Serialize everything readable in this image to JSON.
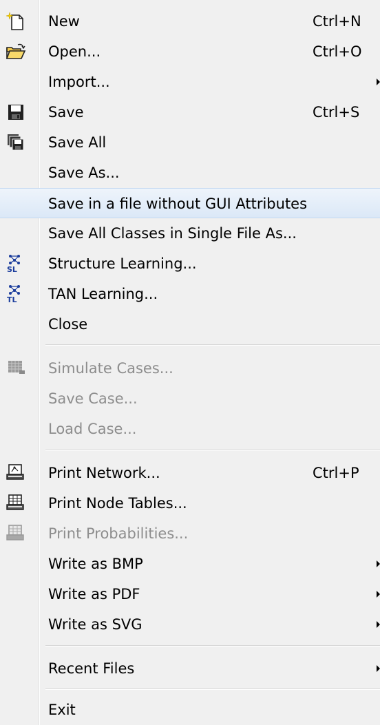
{
  "menu": {
    "items": [
      {
        "label": "New",
        "shortcut": "Ctrl+N",
        "icon": "new-file-icon"
      },
      {
        "label": "Open...",
        "shortcut": "Ctrl+O",
        "icon": "open-folder-icon"
      },
      {
        "label": "Import...",
        "submenu": true
      },
      {
        "label": "Save",
        "shortcut": "Ctrl+S",
        "icon": "save-icon"
      },
      {
        "label": "Save All",
        "icon": "save-all-icon"
      },
      {
        "label": "Save As..."
      },
      {
        "label": "Save in a file without GUI Attributes",
        "highlighted": true
      },
      {
        "label": "Save All Classes in Single File As..."
      },
      {
        "label": "Structure Learning...",
        "icon": "structure-learning-icon",
        "icon_text": "SL"
      },
      {
        "label": "TAN Learning...",
        "icon": "tan-learning-icon",
        "icon_text": "TL"
      },
      {
        "label": "Close"
      },
      {
        "label": "Simulate Cases...",
        "disabled": true,
        "icon": "simulate-cases-icon"
      },
      {
        "label": "Save Case...",
        "disabled": true
      },
      {
        "label": "Load Case...",
        "disabled": true
      },
      {
        "label": "Print Network...",
        "shortcut": "Ctrl+P",
        "icon": "print-network-icon"
      },
      {
        "label": "Print Node Tables...",
        "icon": "print-tables-icon"
      },
      {
        "label": "Print Probabilities...",
        "disabled": true,
        "icon": "print-probabilities-icon"
      },
      {
        "label": "Write as BMP",
        "submenu": true
      },
      {
        "label": "Write as PDF",
        "submenu": true
      },
      {
        "label": "Write as SVG",
        "submenu": true
      },
      {
        "label": "Recent Files",
        "submenu": true
      },
      {
        "label": "Exit"
      }
    ]
  },
  "colors": {
    "highlight_border": "#c3d8f1",
    "disabled_text": "#8d8d8d",
    "background": "#f0f0f0",
    "icon_blue": "#1a3c9c"
  }
}
